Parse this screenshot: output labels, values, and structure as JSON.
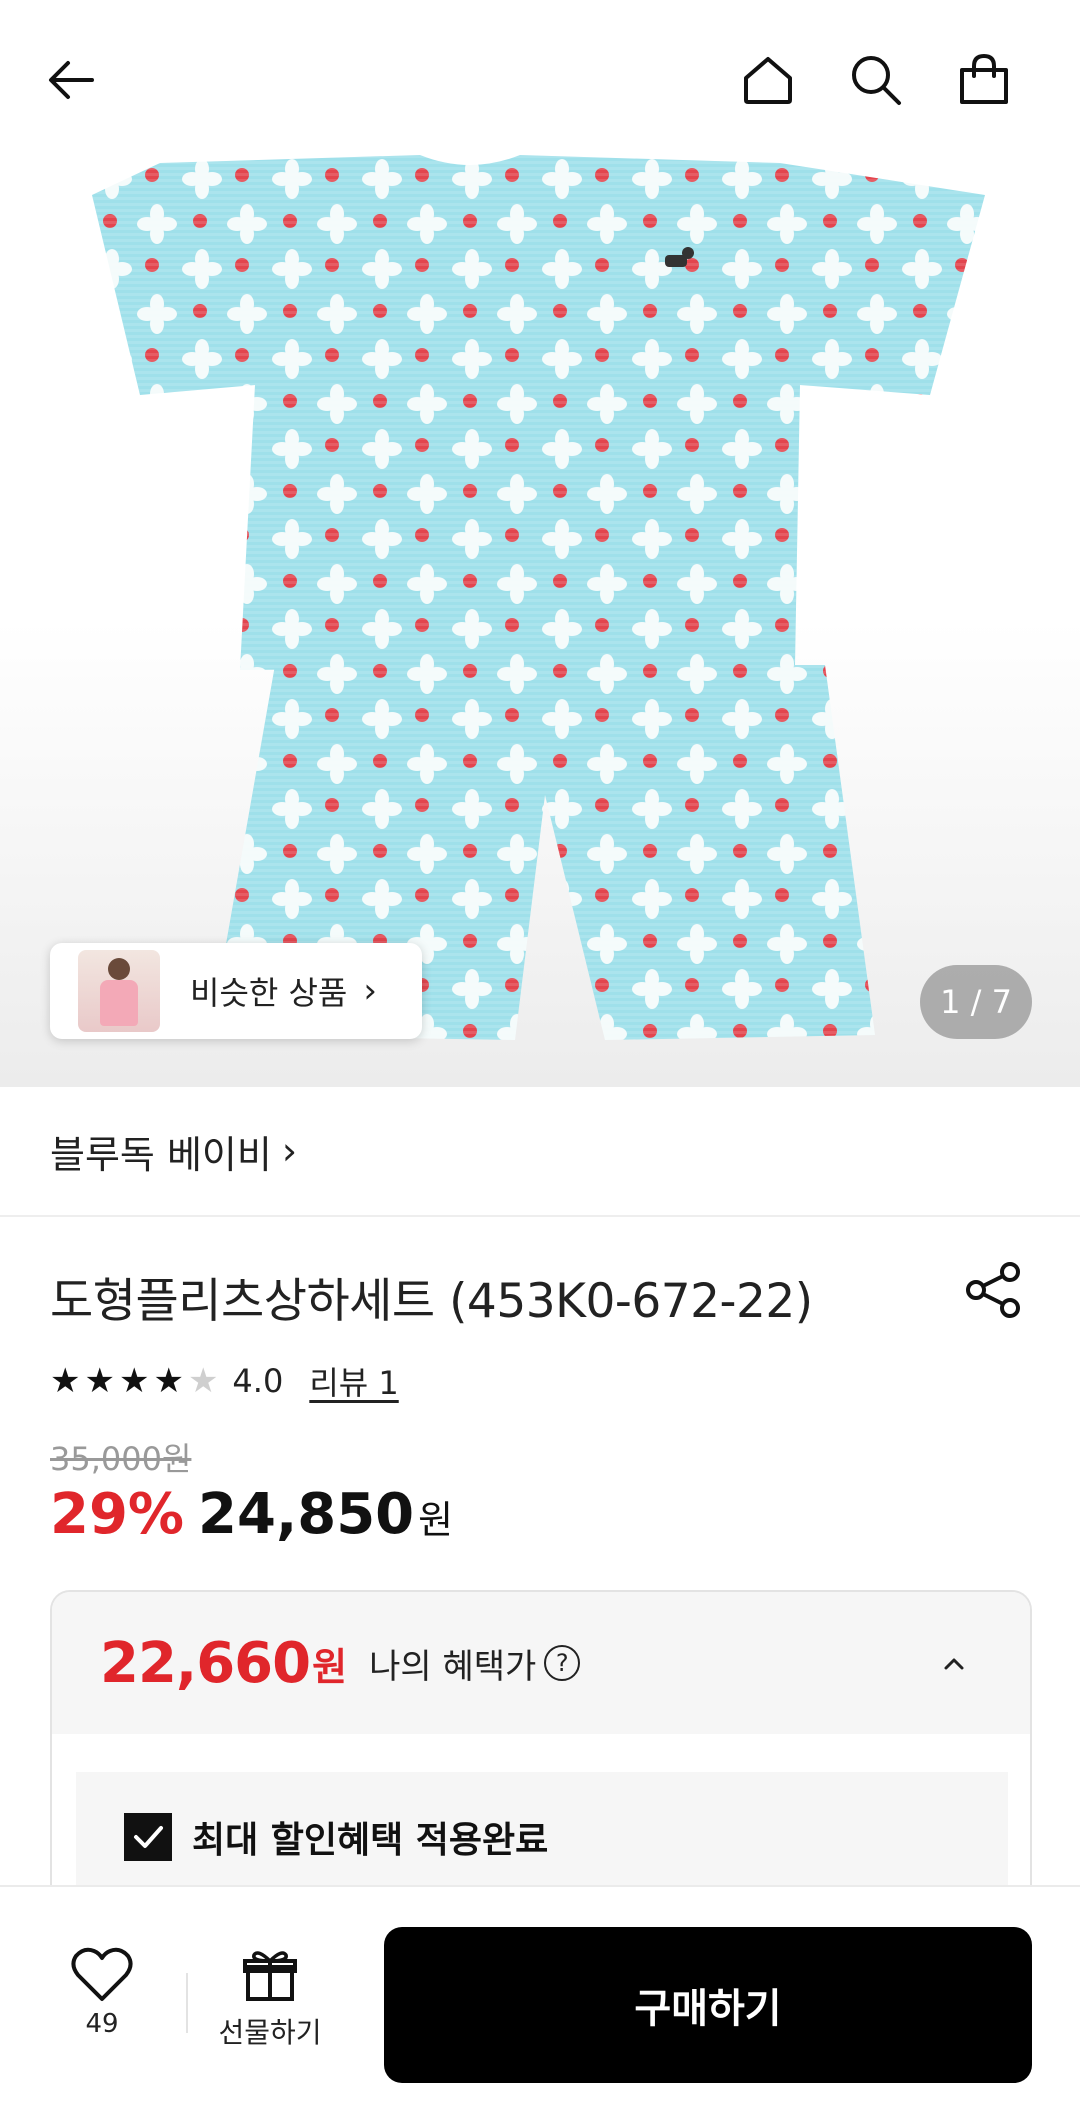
{
  "header": {
    "back_icon": "arrow-left-icon",
    "home_icon": "home-icon",
    "search_icon": "search-icon",
    "cart_icon": "shopping-bag-icon"
  },
  "gallery": {
    "similar_label": "비슷한 상품",
    "counter": "1 / 7"
  },
  "product": {
    "brand": "블루독 베이비",
    "title": "도형플리츠상하세트 (453K0-672-22)",
    "rating": 4.0,
    "rating_text": "4.0",
    "review_label": "리뷰 1",
    "original_price": "35,000원",
    "discount": "29%",
    "sale_price": "24,850",
    "sale_unit": "원"
  },
  "benefit": {
    "price": "22,660",
    "unit": "원",
    "label": "나의 혜택가",
    "help_symbol": "?",
    "applied_label": "최대 할인혜택 적용완료"
  },
  "bottom_bar": {
    "like_count": "49",
    "gift_label": "선물하기",
    "buy_label": "구매하기"
  },
  "colors": {
    "accent_red": "#e0262b",
    "buy_button": "#000000",
    "garment_blue": "#9fe0ea"
  }
}
